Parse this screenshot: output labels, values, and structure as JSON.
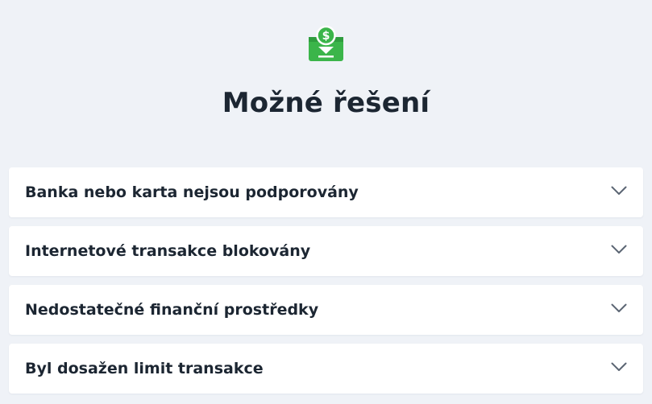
{
  "header": {
    "icon": "money-deposit-icon",
    "title": "Možné řešení"
  },
  "accordion": {
    "items": [
      {
        "label": "Banka nebo karta nejsou podporovány",
        "expanded": false,
        "icon": "chevron-down-icon"
      },
      {
        "label": "Internetové transakce blokovány",
        "expanded": false,
        "icon": "chevron-down-icon"
      },
      {
        "label": "Nedostatečné finanční prostředky",
        "expanded": false,
        "icon": "chevron-down-icon"
      },
      {
        "label": "Byl dosažen limit transakce",
        "expanded": false,
        "icon": "chevron-down-icon"
      }
    ]
  },
  "colors": {
    "background": "#eff2f7",
    "card": "#ffffff",
    "text": "#1c2632",
    "accent_green": "#3bb54a",
    "chevron": "#5b6573"
  }
}
